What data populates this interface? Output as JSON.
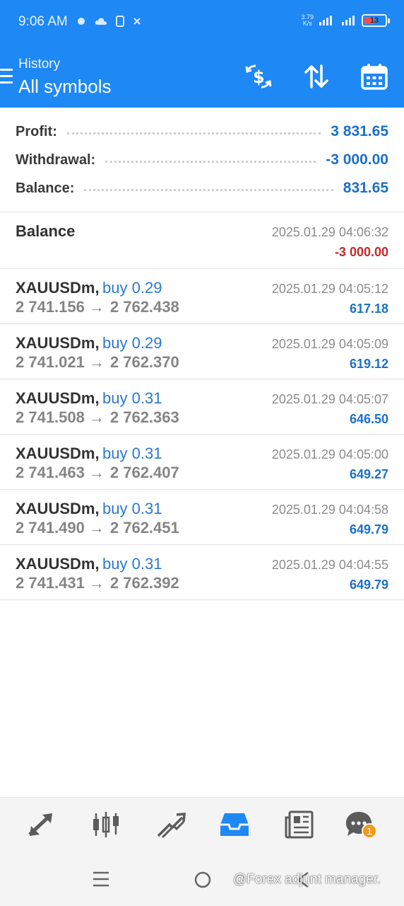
{
  "status_bar": {
    "time": "9:06 AM",
    "network_top": "3.79",
    "network_bottom": "K/s",
    "battery": "13"
  },
  "header": {
    "subtitle": "History",
    "title": "All symbols"
  },
  "summary": {
    "profit_label": "Profit:",
    "profit_value": "3 831.65",
    "withdrawal_label": "Withdrawal:",
    "withdrawal_value": "-3 000.00",
    "balance_label": "Balance:",
    "balance_value": "831.65"
  },
  "balance_entry": {
    "label": "Balance",
    "time": "2025.01.29 04:06:32",
    "amount": "-3 000.00"
  },
  "deals": [
    {
      "symbol": "XAUUSDm,",
      "side": "buy 0.29",
      "open": "2 741.156",
      "close": "2 762.438",
      "time": "2025.01.29 04:05:12",
      "profit": "617.18"
    },
    {
      "symbol": "XAUUSDm,",
      "side": "buy 0.29",
      "open": "2 741.021",
      "close": "2 762.370",
      "time": "2025.01.29 04:05:09",
      "profit": "619.12"
    },
    {
      "symbol": "XAUUSDm,",
      "side": "buy 0.31",
      "open": "2 741.508",
      "close": "2 762.363",
      "time": "2025.01.29 04:05:07",
      "profit": "646.50"
    },
    {
      "symbol": "XAUUSDm,",
      "side": "buy 0.31",
      "open": "2 741.463",
      "close": "2 762.407",
      "time": "2025.01.29 04:05:00",
      "profit": "649.27"
    },
    {
      "symbol": "XAUUSDm,",
      "side": "buy 0.31",
      "open": "2 741.490",
      "close": "2 762.451",
      "time": "2025.01.29 04:04:58",
      "profit": "649.79"
    },
    {
      "symbol": "XAUUSDm,",
      "side": "buy 0.31",
      "open": "2 741.431",
      "close": "2 762.392",
      "time": "2025.01.29 04:04:55",
      "profit": "649.79"
    }
  ],
  "bottom_nav": {
    "items": [
      "quotes-icon",
      "chart-icon",
      "trade-icon",
      "history-icon",
      "news-icon",
      "chat-icon"
    ],
    "active": "history-icon",
    "chat_badge": "1"
  },
  "watermark": "@Forex adjunt manager.",
  "colors": {
    "header_bg": "#1E88F5",
    "value_blue": "#1c70c8",
    "negative_red": "#c62828",
    "active_icon": "#1E88F5",
    "inactive_icon": "#5b5b5b",
    "badge": "#f29a1a"
  }
}
